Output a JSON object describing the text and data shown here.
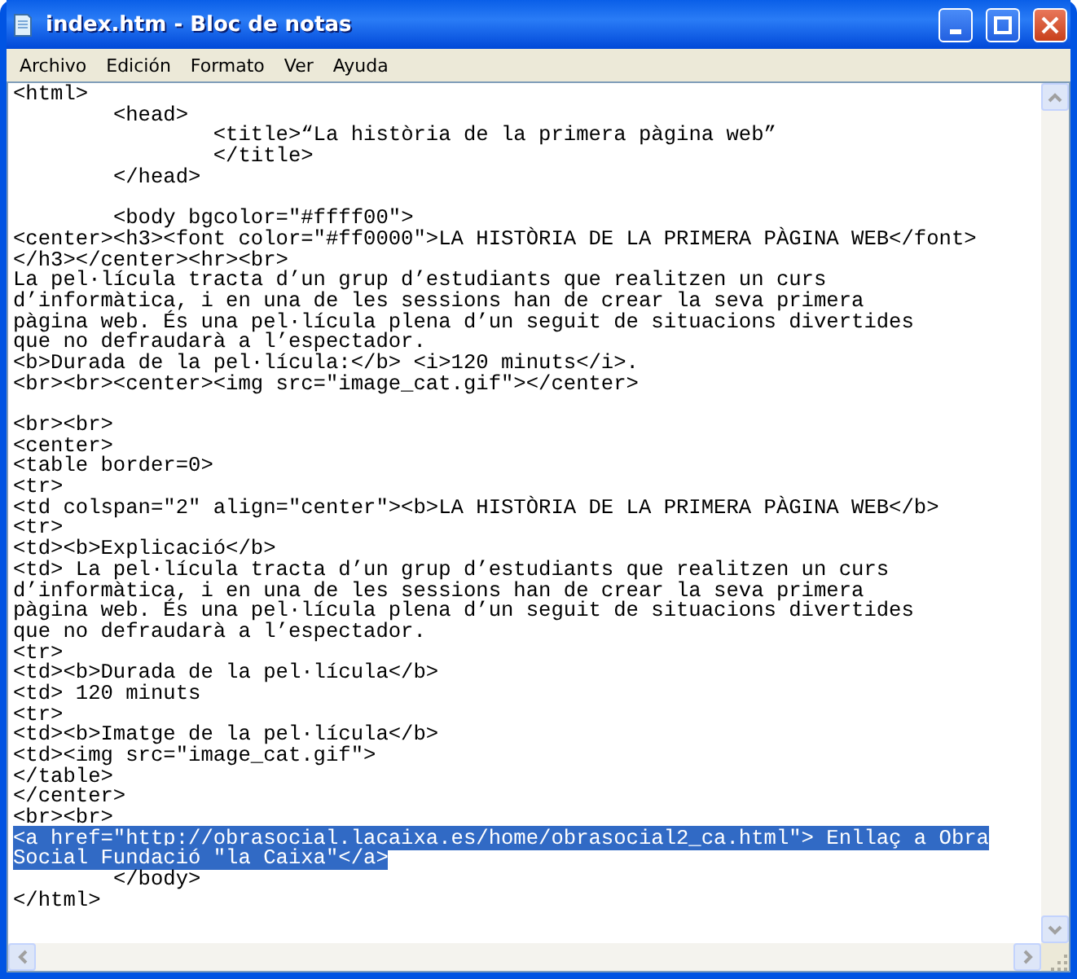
{
  "window": {
    "title": "index.htm - Bloc de notas"
  },
  "menu": [
    "Archivo",
    "Edición",
    "Formato",
    "Ver",
    "Ayuda"
  ],
  "lines": [
    {
      "kind": "text",
      "text": "<html>",
      "selected": false
    },
    {
      "kind": "text",
      "text": "\t<head>",
      "selected": false
    },
    {
      "kind": "text",
      "text": "\t\t<title>“La història de la primera pàgina web”",
      "selected": false
    },
    {
      "kind": "text",
      "text": "\t\t</title>",
      "selected": false
    },
    {
      "kind": "text",
      "text": "\t</head>",
      "selected": false
    },
    {
      "kind": "blank"
    },
    {
      "kind": "text",
      "text": "\t<body bgcolor=\"#ffff00\">",
      "selected": false
    },
    {
      "kind": "text",
      "text": "<center><h3><font color=\"#ff0000\">LA HISTÒRIA DE LA PRIMERA PÀGINA WEB</font>",
      "selected": false
    },
    {
      "kind": "text",
      "text": "</h3></center><hr><br>",
      "selected": false
    },
    {
      "kind": "text",
      "text": "La pel·lícula tracta d’un grup d’estudiants que realitzen un curs",
      "selected": false
    },
    {
      "kind": "text",
      "text": "d’informàtica, i en una de les sessions han de crear la seva primera",
      "selected": false
    },
    {
      "kind": "text",
      "text": "pàgina web. És una pel·lícula plena d’un seguit de situacions divertides",
      "selected": false
    },
    {
      "kind": "text",
      "text": "que no defraudarà a l’espectador.",
      "selected": false
    },
    {
      "kind": "text",
      "text": "<b>Durada de la pel·lícula:</b> <i>120 minuts</i>.",
      "selected": false
    },
    {
      "kind": "text",
      "text": "<br><br><center><img src=\"image_cat.gif\"></center>",
      "selected": false
    },
    {
      "kind": "blank"
    },
    {
      "kind": "text",
      "text": "<br><br>",
      "selected": false
    },
    {
      "kind": "text",
      "text": "<center>",
      "selected": false
    },
    {
      "kind": "text",
      "text": "<table border=0>",
      "selected": false
    },
    {
      "kind": "text",
      "text": "<tr>",
      "selected": false
    },
    {
      "kind": "text",
      "text": "<td colspan=\"2\" align=\"center\"><b>LA HISTÒRIA DE LA PRIMERA PÀGINA WEB</b>",
      "selected": false
    },
    {
      "kind": "text",
      "text": "<tr>",
      "selected": false
    },
    {
      "kind": "text",
      "text": "<td><b>Explicació</b>",
      "selected": false
    },
    {
      "kind": "text",
      "text": "<td> La pel·lícula tracta d’un grup d’estudiants que realitzen un curs",
      "selected": false
    },
    {
      "kind": "text",
      "text": "d’informàtica, i en una de les sessions han de crear la seva primera",
      "selected": false
    },
    {
      "kind": "text",
      "text": "pàgina web. És una pel·lícula plena d’un seguit de situacions divertides",
      "selected": false
    },
    {
      "kind": "text",
      "text": "que no defraudarà a l’espectador.",
      "selected": false
    },
    {
      "kind": "text",
      "text": "<tr>",
      "selected": false
    },
    {
      "kind": "text",
      "text": "<td><b>Durada de la pel·lícula</b>",
      "selected": false
    },
    {
      "kind": "text",
      "text": "<td> 120 minuts",
      "selected": false
    },
    {
      "kind": "text",
      "text": "<tr>",
      "selected": false
    },
    {
      "kind": "text",
      "text": "<td><b>Imatge de la pel·lícula</b>",
      "selected": false
    },
    {
      "kind": "text",
      "text": "<td><img src=\"image_cat.gif\">",
      "selected": false
    },
    {
      "kind": "text",
      "text": "</table>",
      "selected": false
    },
    {
      "kind": "text",
      "text": "</center>",
      "selected": false
    },
    {
      "kind": "text",
      "text": "<br><br>",
      "selected": false
    },
    {
      "kind": "text",
      "text": "<a href=\"http://obrasocial.lacaixa.es/home/obrasocial2_ca.html\"> Enllaç a Obra",
      "selected": true
    },
    {
      "kind": "text",
      "text": "Social Fundació \"la Caixa\"</a>",
      "selected": true
    },
    {
      "kind": "text",
      "text": "\t</body>",
      "selected": false
    },
    {
      "kind": "text",
      "text": "</html>",
      "selected": false
    }
  ]
}
